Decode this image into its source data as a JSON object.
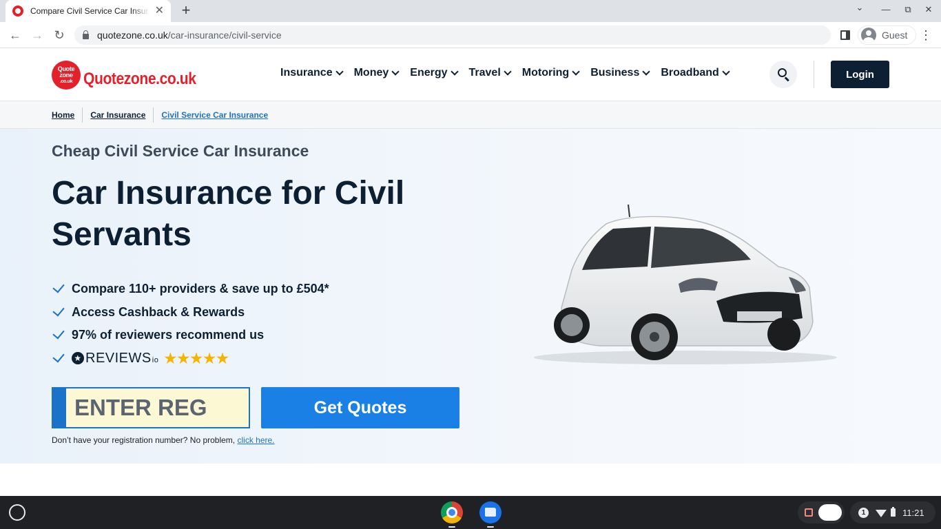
{
  "browser": {
    "tab_title": "Compare Civil Service Car Insurance",
    "new_tab_label": "+",
    "url_host": "quotezone.co.uk",
    "url_path": "/car-insurance/civil-service",
    "profile_label": "Guest",
    "tab_close": "✕",
    "win_down": "⌄",
    "win_min": "—",
    "win_max": "⧉",
    "win_close": "✕",
    "back": "←",
    "forward": "→",
    "reload": "↻",
    "menu": "⋮"
  },
  "site": {
    "logo_badge_lines": [
      "Quote",
      "zone",
      ".co.uk"
    ],
    "logo_text": "Quotezone.co.uk",
    "nav": [
      {
        "label": "Insurance"
      },
      {
        "label": "Money"
      },
      {
        "label": "Energy"
      },
      {
        "label": "Travel"
      },
      {
        "label": "Motoring"
      },
      {
        "label": "Business"
      },
      {
        "label": "Broadband"
      }
    ],
    "login_label": "Login"
  },
  "breadcrumb": {
    "items": [
      "Home",
      "Car Insurance",
      "Civil Service Car Insurance"
    ]
  },
  "hero": {
    "subtitle": "Cheap Civil Service Car Insurance",
    "title": "Car Insurance for Civil Servants",
    "benefits": [
      "Compare 110+ providers & save up to £504*",
      "Access Cashback & Rewards",
      "97% of reviewers recommend us"
    ],
    "reviews_brand": "REVIEWS",
    "reviews_suffix": "io",
    "stars": "★★★★★",
    "reg_placeholder": "ENTER REG",
    "cta_label": "Get Quotes",
    "help_text": "Don’t have your registration number? No problem,",
    "help_link": "click here."
  },
  "shelf": {
    "notification_count": "1",
    "time": "11:21"
  },
  "colors": {
    "brand_red": "#e4202b",
    "navy": "#0d1f33",
    "cta_blue": "#1a80e6",
    "reg_yellow": "#fdf8d4",
    "star_gold": "#f5b400"
  }
}
